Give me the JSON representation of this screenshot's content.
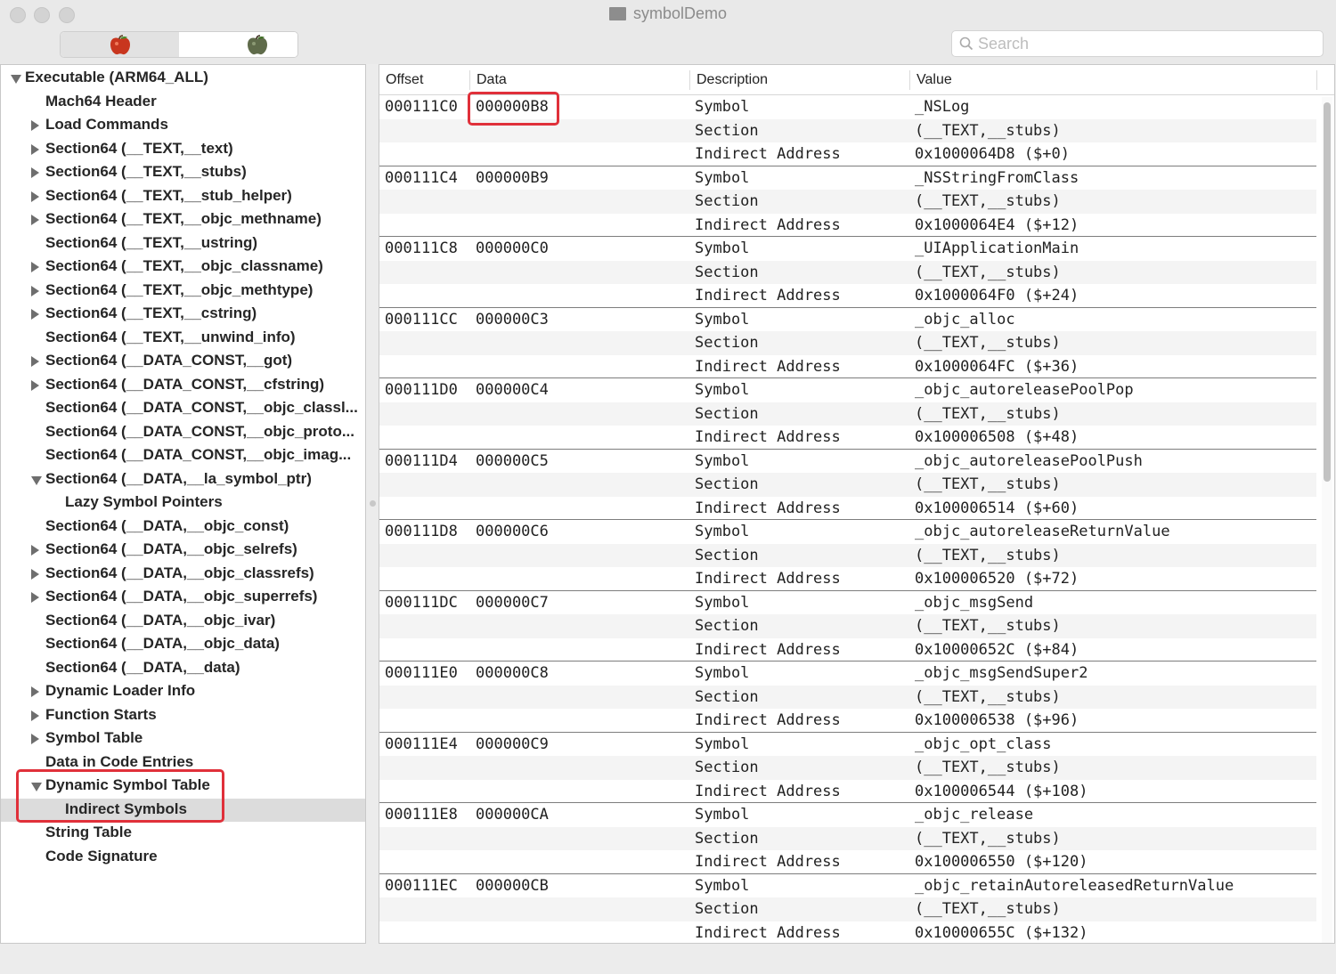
{
  "window": {
    "title": "symbolDemo"
  },
  "toolbar": {
    "search_placeholder": "Search",
    "segments": [
      "apple-red-icon",
      "apple-green-icon"
    ]
  },
  "sidebar": {
    "items": [
      {
        "label": "Executable  (ARM64_ALL)",
        "indent": 0,
        "disclosure": "down"
      },
      {
        "label": "Mach64 Header",
        "indent": 1,
        "disclosure": "none"
      },
      {
        "label": "Load Commands",
        "indent": 1,
        "disclosure": "right"
      },
      {
        "label": "Section64 (__TEXT,__text)",
        "indent": 1,
        "disclosure": "right"
      },
      {
        "label": "Section64 (__TEXT,__stubs)",
        "indent": 1,
        "disclosure": "right"
      },
      {
        "label": "Section64 (__TEXT,__stub_helper)",
        "indent": 1,
        "disclosure": "right"
      },
      {
        "label": "Section64 (__TEXT,__objc_methname)",
        "indent": 1,
        "disclosure": "right"
      },
      {
        "label": "Section64 (__TEXT,__ustring)",
        "indent": 1,
        "disclosure": "none"
      },
      {
        "label": "Section64 (__TEXT,__objc_classname)",
        "indent": 1,
        "disclosure": "right"
      },
      {
        "label": "Section64 (__TEXT,__objc_methtype)",
        "indent": 1,
        "disclosure": "right"
      },
      {
        "label": "Section64 (__TEXT,__cstring)",
        "indent": 1,
        "disclosure": "right"
      },
      {
        "label": "Section64 (__TEXT,__unwind_info)",
        "indent": 1,
        "disclosure": "none"
      },
      {
        "label": "Section64 (__DATA_CONST,__got)",
        "indent": 1,
        "disclosure": "right"
      },
      {
        "label": "Section64 (__DATA_CONST,__cfstring)",
        "indent": 1,
        "disclosure": "right"
      },
      {
        "label": "Section64 (__DATA_CONST,__objc_classl...",
        "indent": 1,
        "disclosure": "none"
      },
      {
        "label": "Section64 (__DATA_CONST,__objc_proto...",
        "indent": 1,
        "disclosure": "none"
      },
      {
        "label": "Section64 (__DATA_CONST,__objc_imag...",
        "indent": 1,
        "disclosure": "none"
      },
      {
        "label": "Section64 (__DATA,__la_symbol_ptr)",
        "indent": 1,
        "disclosure": "down"
      },
      {
        "label": "Lazy Symbol Pointers",
        "indent": 2,
        "disclosure": "none"
      },
      {
        "label": "Section64 (__DATA,__objc_const)",
        "indent": 1,
        "disclosure": "none"
      },
      {
        "label": "Section64 (__DATA,__objc_selrefs)",
        "indent": 1,
        "disclosure": "right"
      },
      {
        "label": "Section64 (__DATA,__objc_classrefs)",
        "indent": 1,
        "disclosure": "right"
      },
      {
        "label": "Section64 (__DATA,__objc_superrefs)",
        "indent": 1,
        "disclosure": "right"
      },
      {
        "label": "Section64 (__DATA,__objc_ivar)",
        "indent": 1,
        "disclosure": "none"
      },
      {
        "label": "Section64 (__DATA,__objc_data)",
        "indent": 1,
        "disclosure": "none"
      },
      {
        "label": "Section64 (__DATA,__data)",
        "indent": 1,
        "disclosure": "none"
      },
      {
        "label": "Dynamic Loader Info",
        "indent": 1,
        "disclosure": "right"
      },
      {
        "label": "Function Starts",
        "indent": 1,
        "disclosure": "right"
      },
      {
        "label": "Symbol Table",
        "indent": 1,
        "disclosure": "right"
      },
      {
        "label": "Data in Code Entries",
        "indent": 1,
        "disclosure": "none"
      },
      {
        "label": "Dynamic Symbol Table",
        "indent": 1,
        "disclosure": "down"
      },
      {
        "label": "Indirect Symbols",
        "indent": 2,
        "disclosure": "none",
        "selected": true
      },
      {
        "label": "String Table",
        "indent": 1,
        "disclosure": "none"
      },
      {
        "label": "Code Signature",
        "indent": 1,
        "disclosure": "none"
      }
    ]
  },
  "table": {
    "headers": [
      "Offset",
      "Data",
      "Description",
      "Value"
    ],
    "records": [
      {
        "offset": "000111C0",
        "data": "000000B8",
        "symbol": "_NSLog",
        "section": "(__TEXT,__stubs)",
        "address": "0x1000064D8 ($+0)"
      },
      {
        "offset": "000111C4",
        "data": "000000B9",
        "symbol": "_NSStringFromClass",
        "section": "(__TEXT,__stubs)",
        "address": "0x1000064E4 ($+12)"
      },
      {
        "offset": "000111C8",
        "data": "000000C0",
        "symbol": "_UIApplicationMain",
        "section": "(__TEXT,__stubs)",
        "address": "0x1000064F0 ($+24)"
      },
      {
        "offset": "000111CC",
        "data": "000000C3",
        "symbol": "_objc_alloc",
        "section": "(__TEXT,__stubs)",
        "address": "0x1000064FC ($+36)"
      },
      {
        "offset": "000111D0",
        "data": "000000C4",
        "symbol": "_objc_autoreleasePoolPop",
        "section": "(__TEXT,__stubs)",
        "address": "0x100006508 ($+48)"
      },
      {
        "offset": "000111D4",
        "data": "000000C5",
        "symbol": "_objc_autoreleasePoolPush",
        "section": "(__TEXT,__stubs)",
        "address": "0x100006514 ($+60)"
      },
      {
        "offset": "000111D8",
        "data": "000000C6",
        "symbol": "_objc_autoreleaseReturnValue",
        "section": "(__TEXT,__stubs)",
        "address": "0x100006520 ($+72)"
      },
      {
        "offset": "000111DC",
        "data": "000000C7",
        "symbol": "_objc_msgSend",
        "section": "(__TEXT,__stubs)",
        "address": "0x10000652C ($+84)"
      },
      {
        "offset": "000111E0",
        "data": "000000C8",
        "symbol": "_objc_msgSendSuper2",
        "section": "(__TEXT,__stubs)",
        "address": "0x100006538 ($+96)"
      },
      {
        "offset": "000111E4",
        "data": "000000C9",
        "symbol": "_objc_opt_class",
        "section": "(__TEXT,__stubs)",
        "address": "0x100006544 ($+108)"
      },
      {
        "offset": "000111E8",
        "data": "000000CA",
        "symbol": "_objc_release",
        "section": "(__TEXT,__stubs)",
        "address": "0x100006550 ($+120)"
      },
      {
        "offset": "000111EC",
        "data": "000000CB",
        "symbol": "_objc_retainAutoreleasedReturnValue",
        "section": "(__TEXT,__stubs)",
        "address": "0x10000655C ($+132)"
      }
    ],
    "row_labels": {
      "symbol": "Symbol",
      "section": "Section",
      "address": "Indirect Address"
    }
  },
  "colors": {
    "highlight": "#e0303a",
    "selection": "#dcdcdc"
  }
}
